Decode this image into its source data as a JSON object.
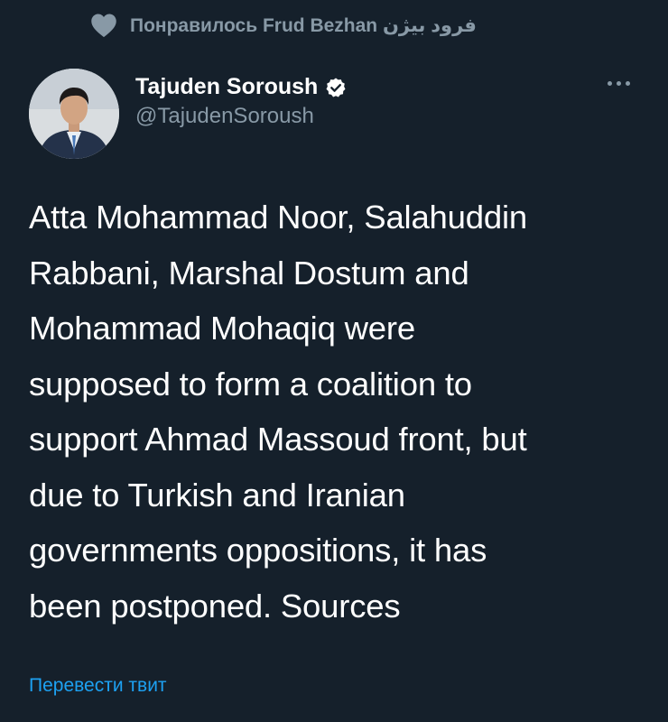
{
  "social_context": {
    "label": "Понравилось Frud Bezhan فرود بيژن",
    "icon": "heart-icon"
  },
  "author": {
    "display_name": "Tajuden Soroush",
    "handle": "@TajudenSoroush",
    "verified": true,
    "verified_icon": "verified-badge-icon",
    "avatar_icon": "avatar"
  },
  "more_menu": {
    "icon": "more-icon"
  },
  "tweet": {
    "lines": [
      "Atta Mohammad Noor, Salahuddin",
      "Rabbani, Marshal Dostum and",
      "Mohammad Mohaqiq were",
      "supposed to form a coalition to",
      "support Ahmad Massoud front, but",
      "due to Turkish and Iranian",
      "governments oppositions, it has",
      "been postponed. Sources"
    ]
  },
  "translate": {
    "label": "Перевести твит"
  },
  "colors": {
    "background": "#15202b",
    "secondary_text": "#8899a6",
    "link": "#1da1f2",
    "verified_badge": "#ffffff"
  }
}
